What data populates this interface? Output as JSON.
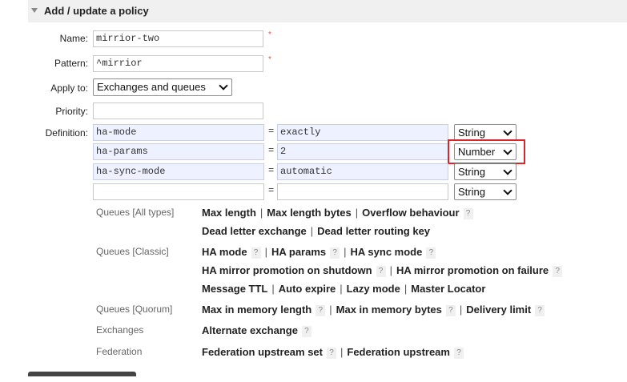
{
  "section": {
    "title": "Add / update a policy"
  },
  "form": {
    "name_label": "Name:",
    "name_value": "mirrior-two",
    "pattern_label": "Pattern:",
    "pattern_value": "^mirrior",
    "apply_label": "Apply to:",
    "apply_value": "Exchanges and queues",
    "priority_label": "Priority:",
    "priority_value": "",
    "definition_label": "Definition:",
    "required_mark": "*"
  },
  "definitions": [
    {
      "key": "ha-mode",
      "eq": "=",
      "value": "exactly",
      "type": "String"
    },
    {
      "key": "ha-params",
      "eq": "=",
      "value": "2",
      "type": "Number"
    },
    {
      "key": "ha-sync-mode",
      "eq": "=",
      "value": "automatic",
      "type": "String"
    },
    {
      "key": "",
      "eq": "=",
      "value": "",
      "type": "String"
    }
  ],
  "help_mark": "?",
  "sep": "|",
  "categories": {
    "queues_all": {
      "label": "Queues [All types]",
      "line1": [
        "Max length",
        "Max length bytes",
        "Overflow behaviour"
      ],
      "line2": [
        "Dead letter exchange",
        "Dead letter routing key"
      ]
    },
    "queues_classic": {
      "label": "Queues [Classic]",
      "line1": [
        "HA mode",
        "HA params",
        "HA sync mode"
      ],
      "line2": [
        "HA mirror promotion on shutdown",
        "HA mirror promotion on failure"
      ],
      "line3": [
        "Message TTL",
        "Auto expire",
        "Lazy mode",
        "Master Locator"
      ]
    },
    "queues_quorum": {
      "label": "Queues [Quorum]",
      "line1": [
        "Max in memory length",
        "Max in memory bytes",
        "Delivery limit"
      ]
    },
    "exchanges": {
      "label": "Exchanges",
      "line1": [
        "Alternate exchange"
      ]
    },
    "federation": {
      "label": "Federation",
      "line1": [
        "Federation upstream set",
        "Federation upstream"
      ]
    }
  }
}
